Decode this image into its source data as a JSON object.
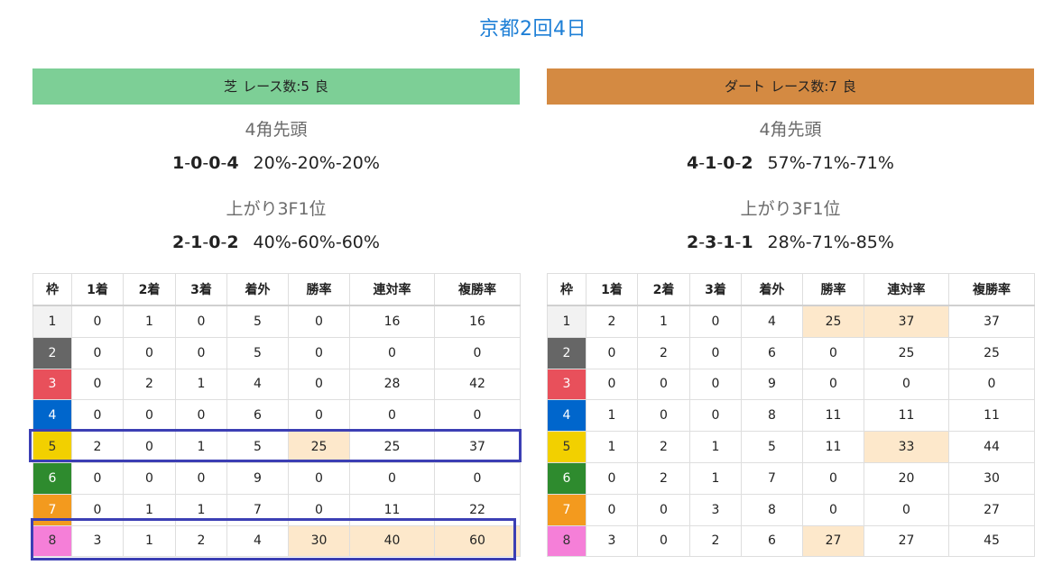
{
  "page_title": "京都2回4日",
  "columns": [
    "枠",
    "1着",
    "2着",
    "3着",
    "着外",
    "勝率",
    "連対率",
    "複勝率"
  ],
  "frame_colors": [
    "#f2f2f2",
    "#666666",
    "#e8505b",
    "#0066cc",
    "#f2d000",
    "#2e8b2e",
    "#f39a1e",
    "#f57fd8"
  ],
  "frame_text_colors": [
    "#222222",
    "#ffffff",
    "#ffffff",
    "#ffffff",
    "#333333",
    "#ffffff",
    "#ffffff",
    "#333333"
  ],
  "highlight_color": "#fde8cb",
  "box_color": "#3c3fb4",
  "panels": [
    {
      "header": {
        "track": "芝",
        "races": "レース数:5",
        "condition": "良",
        "color": "#7dcf96"
      },
      "lead_label": "4角先頭",
      "lead_record": [
        "1",
        "0",
        "0",
        "4"
      ],
      "lead_pct": "20%-20%-20%",
      "last3f_label": "上がり3F1位",
      "last3f_record": [
        "2",
        "1",
        "0",
        "2"
      ],
      "last3f_pct": "40%-60%-60%",
      "rows": [
        {
          "frame": "1",
          "cells": [
            "0",
            "1",
            "0",
            "5",
            "0",
            "16",
            "16"
          ],
          "hl": []
        },
        {
          "frame": "2",
          "cells": [
            "0",
            "0",
            "0",
            "5",
            "0",
            "0",
            "0"
          ],
          "hl": []
        },
        {
          "frame": "3",
          "cells": [
            "0",
            "2",
            "1",
            "4",
            "0",
            "28",
            "42"
          ],
          "hl": []
        },
        {
          "frame": "4",
          "cells": [
            "0",
            "0",
            "0",
            "6",
            "0",
            "0",
            "0"
          ],
          "hl": []
        },
        {
          "frame": "5",
          "cells": [
            "2",
            "0",
            "1",
            "5",
            "25",
            "25",
            "37"
          ],
          "hl": [
            4
          ]
        },
        {
          "frame": "6",
          "cells": [
            "0",
            "0",
            "0",
            "9",
            "0",
            "0",
            "0"
          ],
          "hl": []
        },
        {
          "frame": "7",
          "cells": [
            "0",
            "1",
            "1",
            "7",
            "0",
            "11",
            "22"
          ],
          "hl": []
        },
        {
          "frame": "8",
          "cells": [
            "3",
            "1",
            "2",
            "4",
            "30",
            "40",
            "60"
          ],
          "hl": [
            4,
            5,
            6
          ]
        }
      ]
    },
    {
      "header": {
        "track": "ダート",
        "races": "レース数:7",
        "condition": "良",
        "color": "#d48a42"
      },
      "lead_label": "4角先頭",
      "lead_record": [
        "4",
        "1",
        "0",
        "2"
      ],
      "lead_pct": "57%-71%-71%",
      "last3f_label": "上がり3F1位",
      "last3f_record": [
        "2",
        "3",
        "1",
        "1"
      ],
      "last3f_pct": "28%-71%-85%",
      "rows": [
        {
          "frame": "1",
          "cells": [
            "2",
            "1",
            "0",
            "4",
            "25",
            "37",
            "37"
          ],
          "hl": [
            4,
            5
          ]
        },
        {
          "frame": "2",
          "cells": [
            "0",
            "2",
            "0",
            "6",
            "0",
            "25",
            "25"
          ],
          "hl": []
        },
        {
          "frame": "3",
          "cells": [
            "0",
            "0",
            "0",
            "9",
            "0",
            "0",
            "0"
          ],
          "hl": []
        },
        {
          "frame": "4",
          "cells": [
            "1",
            "0",
            "0",
            "8",
            "11",
            "11",
            "11"
          ],
          "hl": []
        },
        {
          "frame": "5",
          "cells": [
            "1",
            "2",
            "1",
            "5",
            "11",
            "33",
            "44"
          ],
          "hl": [
            5
          ]
        },
        {
          "frame": "6",
          "cells": [
            "0",
            "2",
            "1",
            "7",
            "0",
            "20",
            "30"
          ],
          "hl": []
        },
        {
          "frame": "7",
          "cells": [
            "0",
            "0",
            "3",
            "8",
            "0",
            "0",
            "27"
          ],
          "hl": []
        },
        {
          "frame": "8",
          "cells": [
            "3",
            "0",
            "2",
            "6",
            "27",
            "27",
            "45"
          ],
          "hl": [
            4
          ]
        }
      ]
    }
  ]
}
